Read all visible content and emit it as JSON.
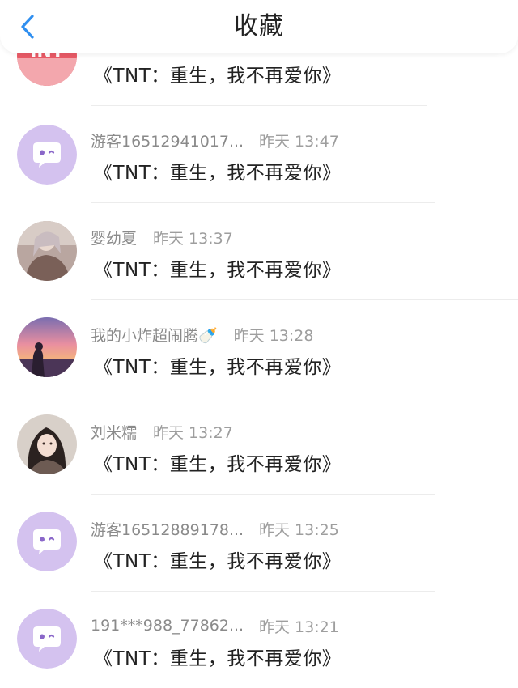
{
  "header": {
    "title": "收藏",
    "back_icon": "chevron-left-icon",
    "accent": "#2f8ff0"
  },
  "items": [
    {
      "name": "",
      "time": "",
      "message": "《TNT：重生，我不再爱你》",
      "avatar": "red-logo-avatar"
    },
    {
      "name": "游客16512941017...",
      "time": "昨天 13:47",
      "message": "《TNT：重生，我不再爱你》",
      "avatar": "default-chat-avatar"
    },
    {
      "name": "婴幼夏",
      "time": "昨天 13:37",
      "message": "《TNT：重生，我不再爱你》",
      "avatar": "photo-avatar"
    },
    {
      "name": "我的小炸超闹腾🍼",
      "time": "昨天 13:28",
      "message": "《TNT：重生，我不再爱你》",
      "avatar": "sunset-photo-avatar"
    },
    {
      "name": "刘米糯",
      "time": "昨天 13:27",
      "message": "《TNT：重生，我不再爱你》",
      "avatar": "girl-photo-avatar"
    },
    {
      "name": "游客16512889178...",
      "time": "昨天 13:25",
      "message": "《TNT：重生，我不再爱你》",
      "avatar": "default-chat-avatar"
    },
    {
      "name": "191***988_77862...",
      "time": "昨天 13:21",
      "message": "《TNT：重生，我不再爱你》",
      "avatar": "default-chat-avatar"
    }
  ],
  "colors": {
    "default_avatar_bg": "#d4c2ef",
    "default_avatar_bubble": "#ffffff",
    "default_avatar_eye": "#8a67c9"
  }
}
